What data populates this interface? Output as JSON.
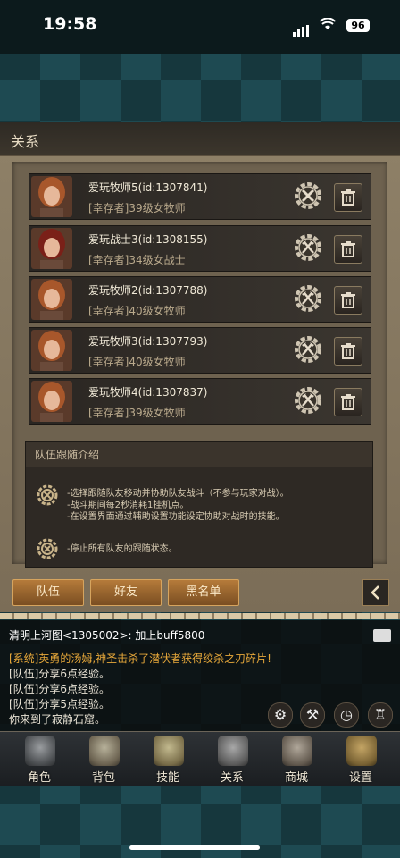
{
  "status_bar": {
    "time": "19:58",
    "battery": "96"
  },
  "panel": {
    "title": "关系"
  },
  "party_members": [
    {
      "name": "爱玩牧师5(id:1307841)",
      "info": "[幸存者]39级女牧师",
      "action_icon": "gear-x-icon"
    },
    {
      "name": "爱玩战士3(id:1308155)",
      "info": "[幸存者]34级女战士",
      "action_icon": "gear-axes-icon"
    },
    {
      "name": "爱玩牧师2(id:1307788)",
      "info": "[幸存者]40级女牧师",
      "action_icon": "gear-axes-icon"
    },
    {
      "name": "爱玩牧师3(id:1307793)",
      "info": "[幸存者]40级女牧师",
      "action_icon": "gear-axes-icon"
    },
    {
      "name": "爱玩牧师4(id:1307837)",
      "info": "[幸存者]39级女牧师",
      "action_icon": "gear-axes-icon"
    }
  ],
  "intro": {
    "title": "队伍跟随介绍",
    "follow_lines": [
      "-选择跟随队友移动并协助队友战斗（不参与玩家对战）。",
      "-战斗期间每2秒消耗1挂机点。",
      "-在设置界面通过辅助设置功能设定协助对战时的技能。"
    ],
    "stop_line": "-停止所有队友的跟随状态。"
  },
  "tabs": {
    "team": "队伍",
    "friends": "好友",
    "blacklist": "黑名单"
  },
  "chat": {
    "top_line": "清明上河图<1305002>:  加上buff5800",
    "lines": [
      {
        "text": "[系统]英勇的汤姆,神圣击杀了潜伏者获得绞杀之刃碎片!",
        "type": "system"
      },
      {
        "text": "[队伍]分享6点经验。",
        "type": "normal"
      },
      {
        "text": "[队伍]分享6点经验。",
        "type": "normal"
      },
      {
        "text": "[队伍]分享5点经验。",
        "type": "normal"
      },
      {
        "text": "你来到了寂静石窟。",
        "type": "normal"
      }
    ]
  },
  "nav": {
    "character": "角色",
    "bag": "背包",
    "skills": "技能",
    "relations": "关系",
    "shop": "商城",
    "settings": "设置"
  },
  "colors": {
    "accent_tab": "#b57b3a",
    "system_text": "#e7a83a",
    "panel": "#8f8168"
  }
}
